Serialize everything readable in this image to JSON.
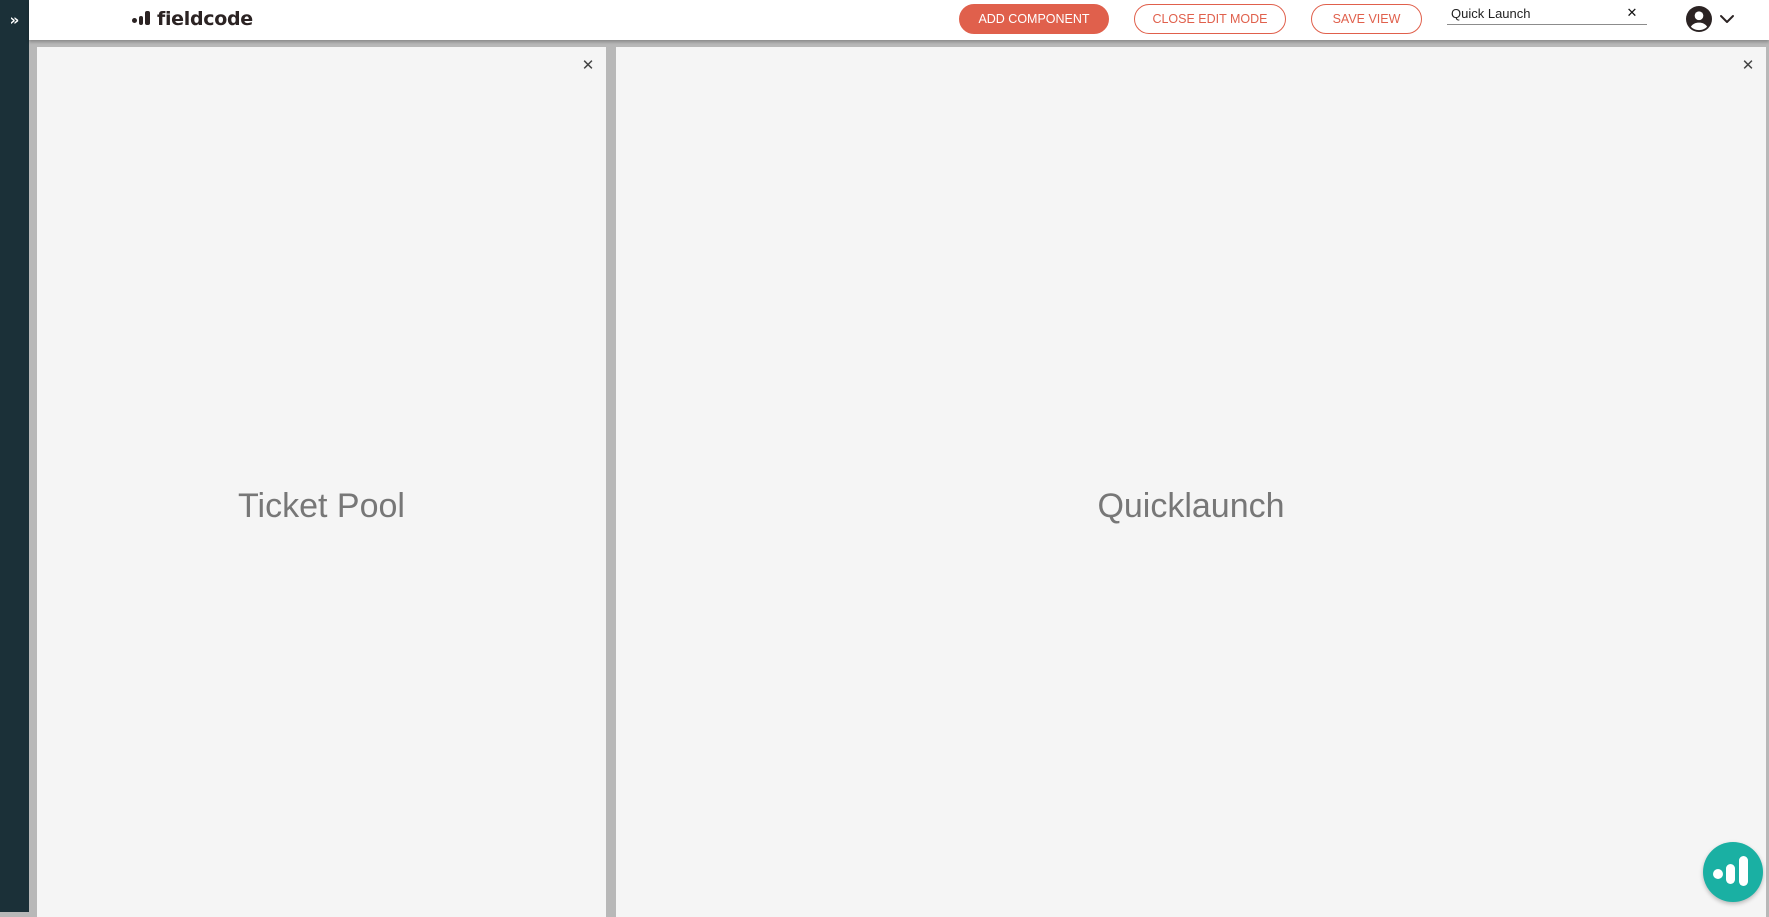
{
  "sidebar": {
    "toggle_icon": "double-chevron-right-icon",
    "toggle_glyph": "»"
  },
  "header": {
    "logo_text": "fieldcode",
    "buttons": {
      "add_component": "ADD COMPONENT",
      "close_edit_mode": "CLOSE EDIT MODE",
      "save_view": "SAVE VIEW"
    },
    "view_name": {
      "value": "Quick Launch",
      "clear_glyph": "✕"
    },
    "user_menu": {
      "avatar_icon": "account-circle-icon",
      "chevron_icon": "chevron-down-icon"
    }
  },
  "panels": [
    {
      "title": "Ticket Pool",
      "close_glyph": "✕"
    },
    {
      "title": "Quicklaunch",
      "close_glyph": "✕"
    }
  ],
  "fab": {
    "icon": "fieldcode-logo-icon"
  },
  "colors": {
    "sidebar_bg": "#1b3038",
    "accent": "#e0604c",
    "panel_bg": "#f5f5f5",
    "canvas_bg": "#b8b8b8",
    "fab_bg": "#1ab0a3",
    "panel_title": "#777777"
  }
}
